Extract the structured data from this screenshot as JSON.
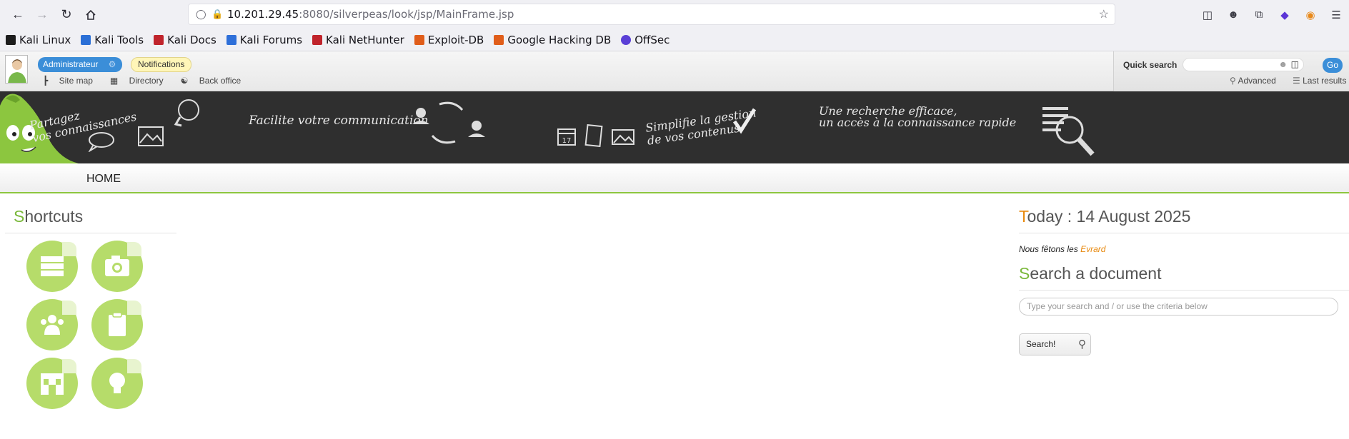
{
  "browser": {
    "url_host": "10.201.29.45",
    "url_rest": ":8080/silverpeas/look/jsp/MainFrame.jsp",
    "bookmarks": [
      {
        "label": "Kali Linux",
        "color": "#2b6fd6"
      },
      {
        "label": "Kali Tools",
        "color": "#d63b3b"
      },
      {
        "label": "Kali Docs",
        "color": "#c0242c"
      },
      {
        "label": "Kali Forums",
        "color": "#2e6fd9"
      },
      {
        "label": "Kali NetHunter",
        "color": "#c0242c"
      },
      {
        "label": "Exploit-DB",
        "color": "#e05d1a"
      },
      {
        "label": "Google Hacking DB",
        "color": "#e05d1a"
      },
      {
        "label": "OffSec",
        "color": "#5a3fd6"
      }
    ]
  },
  "topbar": {
    "admin_label": "Administrateur",
    "notifications_label": "Notifications",
    "site_map": "Site map",
    "directory": "Directory",
    "back_office": "Back office",
    "quick_search_label": "Quick search",
    "go_label": "Go",
    "advanced": "Advanced",
    "last_results": "Last results"
  },
  "banner": {
    "t1": "Partagez",
    "t2": "vos connaissances",
    "t3": "Facilite votre communication",
    "t4": "Simplifie la gestion",
    "t5": "de vos contenus",
    "t6": "Une recherche efficace,",
    "t7": "un accès à la connaissance rapide",
    "calendar_day": "17"
  },
  "nav": {
    "home": "HOME"
  },
  "main": {
    "shortcuts_first": "S",
    "shortcuts_rest": "hortcuts",
    "today_first": "T",
    "today_rest": "oday : 14 August 2025",
    "fete_prefix": "Nous fêtons les",
    "fete_name": "Evrard",
    "searchdoc_first": "S",
    "searchdoc_rest": "earch a document",
    "search_placeholder": "Type your search and / or use the criteria below",
    "search_button": "Search!"
  },
  "colors": {
    "accent_green": "#7ab83a",
    "accent_orange": "#e88a10",
    "button_blue": "#3b8ed8"
  }
}
